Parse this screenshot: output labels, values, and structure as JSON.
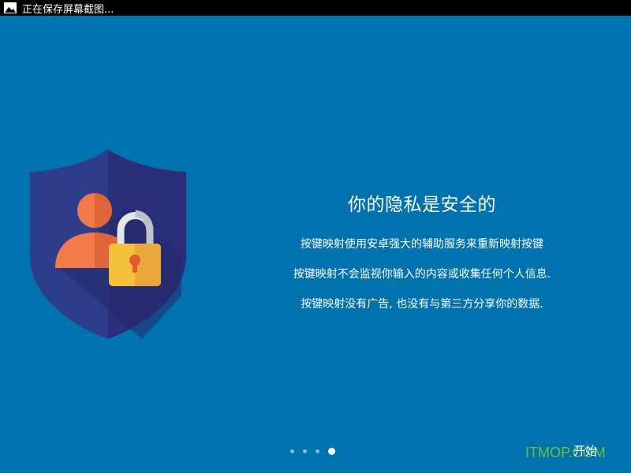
{
  "status_bar": {
    "text": "正在保存屏幕截图..."
  },
  "onboarding": {
    "title": "你的隐私是安全的",
    "lines": [
      "按键映射使用安卓强大的辅助服务来重新映射按键",
      "按键映射不会监视你输入的内容或收集任何个人信息.",
      "按键映射没有广告, 也没有与第三方分享你的数据."
    ],
    "page_indicator": {
      "total": 4,
      "current": 4
    },
    "start_label": "开始",
    "illustration_icons": [
      "shield-icon",
      "user-icon",
      "padlock-icon"
    ]
  },
  "watermark": {
    "text": "ITMOP.COM"
  },
  "colors": {
    "background": "#0072ad",
    "shield_outer": "#2d3d8a",
    "shield_inner": "#2a2f7a",
    "person": "#f07a4a",
    "lock_body": "#f4c23a",
    "lock_keyhole": "#e35a2f"
  }
}
